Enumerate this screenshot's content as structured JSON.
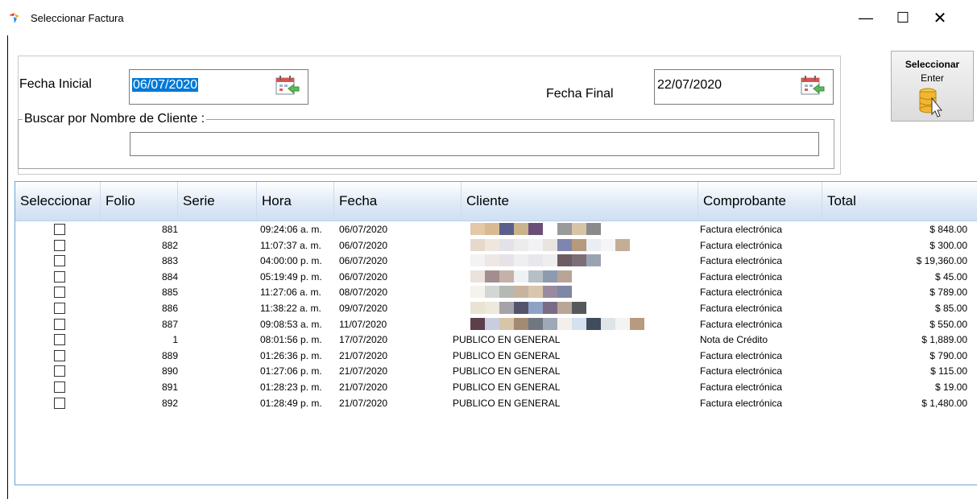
{
  "window": {
    "title": "Seleccionar Factura",
    "minimize": "—",
    "maximize": "☐",
    "close": "✕"
  },
  "filters": {
    "fecha_inicial_label": "Fecha Inicial",
    "fecha_inicial_value": "06/07/2020",
    "fecha_final_label": "Fecha Final",
    "fecha_final_value": "22/07/2020",
    "search_group_label": "Buscar por Nombre de Cliente :",
    "search_value": ""
  },
  "select_button": {
    "label": "Seleccionar",
    "shortcut": "Enter"
  },
  "grid": {
    "columns": [
      "Seleccionar",
      "Folio",
      "Serie",
      "Hora",
      "Fecha",
      "Cliente",
      "Comprobante",
      "Total"
    ],
    "rows": [
      {
        "checked": false,
        "folio": "881",
        "serie": "",
        "hora": "09:24:06 a. m.",
        "fecha": "06/07/2020",
        "cliente": "",
        "comprobante": "Factura electrónica",
        "total": "$ 848.00"
      },
      {
        "checked": false,
        "folio": "882",
        "serie": "",
        "hora": "11:07:37 a. m.",
        "fecha": "06/07/2020",
        "cliente": "",
        "comprobante": "Factura electrónica",
        "total": "$ 300.00"
      },
      {
        "checked": false,
        "folio": "883",
        "serie": "",
        "hora": "04:00:00 p. m.",
        "fecha": "06/07/2020",
        "cliente": "",
        "comprobante": "Factura electrónica",
        "total": "$ 19,360.00"
      },
      {
        "checked": false,
        "folio": "884",
        "serie": "",
        "hora": "05:19:49 p. m.",
        "fecha": "06/07/2020",
        "cliente": "",
        "comprobante": "Factura electrónica",
        "total": "$ 45.00"
      },
      {
        "checked": false,
        "folio": "885",
        "serie": "",
        "hora": "11:27:06 a. m.",
        "fecha": "08/07/2020",
        "cliente": "",
        "comprobante": "Factura electrónica",
        "total": "$ 789.00"
      },
      {
        "checked": false,
        "folio": "886",
        "serie": "",
        "hora": "11:38:22 a. m.",
        "fecha": "09/07/2020",
        "cliente": "",
        "comprobante": "Factura electrónica",
        "total": "$ 85.00"
      },
      {
        "checked": false,
        "folio": "887",
        "serie": "",
        "hora": "09:08:53 a. m.",
        "fecha": "11/07/2020",
        "cliente": "",
        "comprobante": "Factura electrónica",
        "total": "$ 550.00"
      },
      {
        "checked": false,
        "folio": "1",
        "serie": "",
        "hora": "08:01:56 p. m.",
        "fecha": "17/07/2020",
        "cliente": "PUBLICO EN GENERAL",
        "comprobante": "Nota de Crédito",
        "total": "$ 1,889.00"
      },
      {
        "checked": false,
        "folio": "889",
        "serie": "",
        "hora": "01:26:36 p. m.",
        "fecha": "21/07/2020",
        "cliente": "PUBLICO EN GENERAL",
        "comprobante": "Factura electrónica",
        "total": "$ 790.00"
      },
      {
        "checked": false,
        "folio": "890",
        "serie": "",
        "hora": "01:27:06 p. m.",
        "fecha": "21/07/2020",
        "cliente": "PUBLICO EN GENERAL",
        "comprobante": "Factura electrónica",
        "total": "$ 115.00"
      },
      {
        "checked": false,
        "folio": "891",
        "serie": "",
        "hora": "01:28:23 p. m.",
        "fecha": "21/07/2020",
        "cliente": "PUBLICO EN GENERAL",
        "comprobante": "Factura electrónica",
        "total": "$ 19.00"
      },
      {
        "checked": false,
        "folio": "892",
        "serie": "",
        "hora": "01:28:49 p. m.",
        "fecha": "21/07/2020",
        "cliente": "PUBLICO EN GENERAL",
        "comprobante": "Factura electrónica",
        "total": "$ 1,480.00"
      }
    ]
  },
  "colors": {
    "selection": "#0078d7",
    "grid_border": "#6fa3d6",
    "header_gradient_end": "#cfdff2"
  },
  "icons": [
    "app-icon",
    "calendar-icon",
    "database-cursor-icon"
  ]
}
